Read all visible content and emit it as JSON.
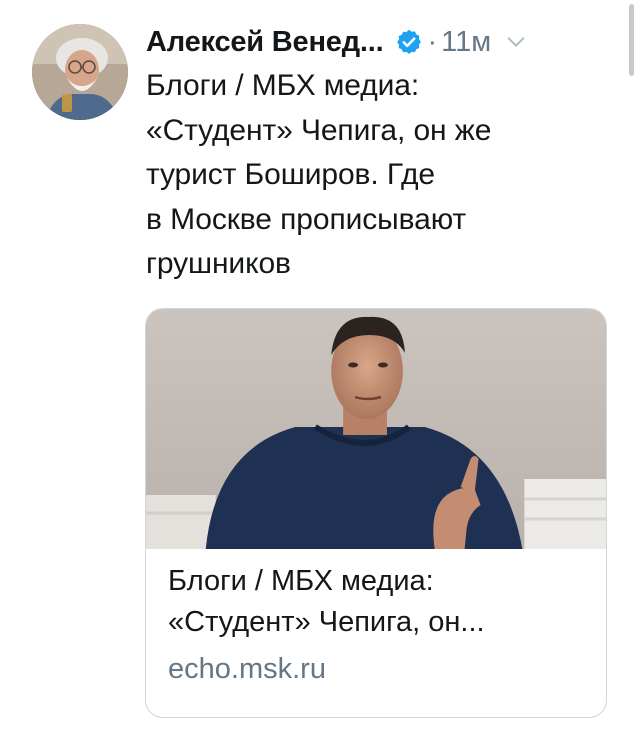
{
  "tweet": {
    "author_name": "Алексей Венед...",
    "separator": "·",
    "time": "11м",
    "text": "Блоги / МБХ медиа:\n«Студент» Чепига, он же\nтурист Боширов. Где\nв Москве прописывают\nгрушников"
  },
  "card": {
    "title": "Блоги / МБХ медиа:\n«Студент» Чепига, он...",
    "domain": "echo.msk.ru"
  },
  "icons": {
    "verified": "verified-badge-icon",
    "more": "chevron-down-icon"
  },
  "colors": {
    "verified_blue": "#1da1f2",
    "secondary_text": "#657786",
    "border": "#ccd6dd"
  }
}
